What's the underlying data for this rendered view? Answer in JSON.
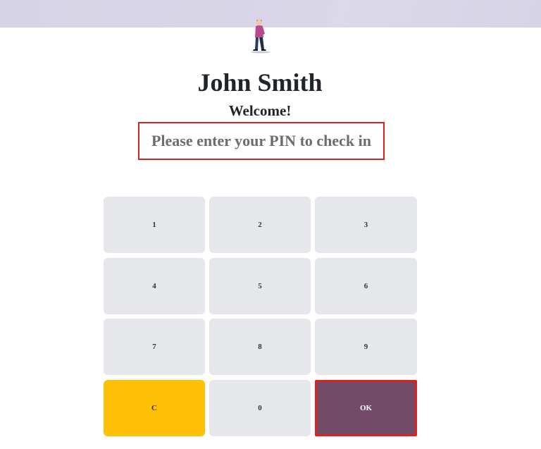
{
  "employee": {
    "name": "John Smith",
    "welcome": "Welcome!",
    "instruction": "Please enter your PIN to check in",
    "avatar_icon": "person-standing-illustration"
  },
  "keypad": {
    "keys": [
      "1",
      "2",
      "3",
      "4",
      "5",
      "6",
      "7",
      "8",
      "9",
      "C",
      "0",
      "OK"
    ],
    "clear_color": "#ffc107",
    "ok_color": "#714b67",
    "key_color": "#e6e7eb"
  },
  "theme": {
    "highlight_border": "#e02020",
    "top_band": "#d6d3e6"
  }
}
